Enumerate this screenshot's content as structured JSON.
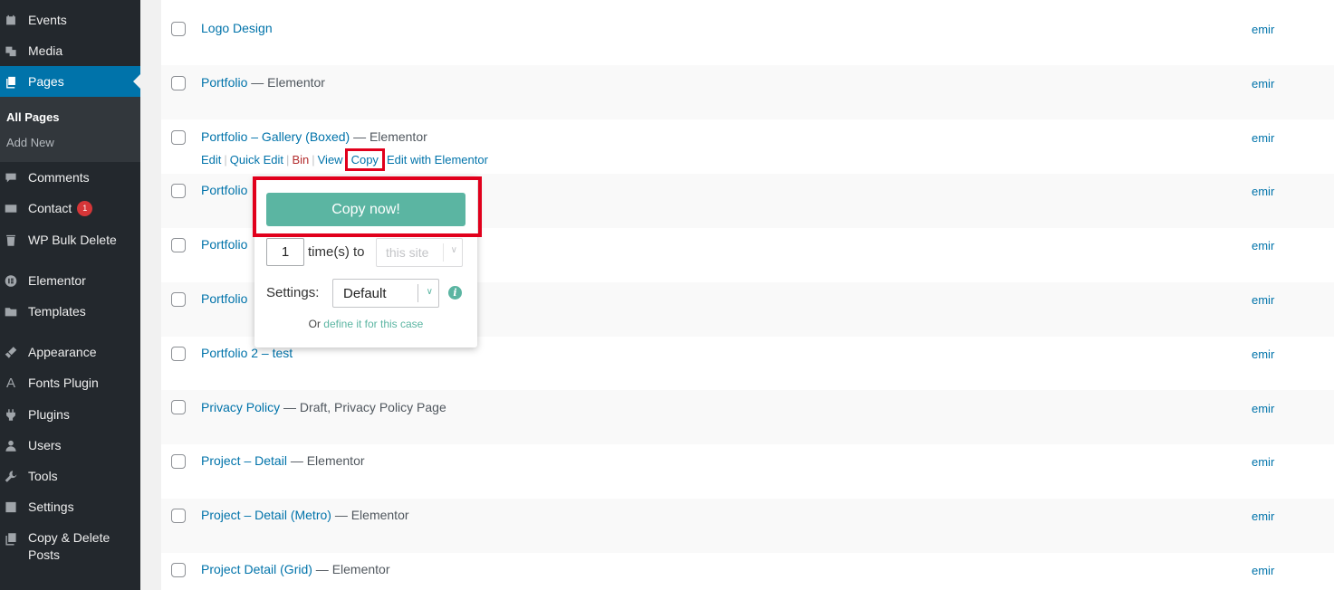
{
  "sidebar": {
    "items": [
      {
        "label": "Events",
        "icon": "calendar-icon"
      },
      {
        "label": "Media",
        "icon": "media-icon"
      },
      {
        "label": "Pages",
        "icon": "pages-icon"
      },
      {
        "label": "Comments",
        "icon": "comments-icon"
      },
      {
        "label": "Contact",
        "icon": "mail-icon",
        "badge": "1"
      },
      {
        "label": "WP Bulk Delete",
        "icon": "trash-icon"
      },
      {
        "label": "Elementor",
        "icon": "elementor-icon"
      },
      {
        "label": "Templates",
        "icon": "folder-icon"
      },
      {
        "label": "Appearance",
        "icon": "brush-icon"
      },
      {
        "label": "Fonts Plugin",
        "icon": "font-icon"
      },
      {
        "label": "Plugins",
        "icon": "plugin-icon"
      },
      {
        "label": "Users",
        "icon": "user-icon"
      },
      {
        "label": "Tools",
        "icon": "wrench-icon"
      },
      {
        "label": "Settings",
        "icon": "settings-icon"
      },
      {
        "label_line1": "Copy & Delete",
        "label_line2": "Posts",
        "icon": "copy-delete-icon"
      }
    ],
    "submenu": {
      "all_pages": "All Pages",
      "add_new": "Add New"
    }
  },
  "pages": [
    {
      "title": "Logo Design",
      "state": "",
      "author": "emir"
    },
    {
      "title": "Portfolio",
      "state": " — Elementor",
      "author": "emir"
    },
    {
      "title": "Portfolio – Gallery (Boxed)",
      "state": " — Elementor",
      "author": "emir"
    },
    {
      "title": "Portfolio",
      "state": "",
      "author": "emir"
    },
    {
      "title": "Portfolio",
      "state": "",
      "author": "emir"
    },
    {
      "title": "Portfolio",
      "state": "",
      "author": "emir"
    },
    {
      "title": "Portfolio 2 – test",
      "state": "",
      "author": "emir"
    },
    {
      "title": "Privacy Policy",
      "state": " — Draft, Privacy Policy Page",
      "author": "emir"
    },
    {
      "title": "Project – Detail",
      "state": " — Elementor",
      "author": "emir"
    },
    {
      "title": "Project – Detail (Metro)",
      "state": " — Elementor",
      "author": "emir"
    },
    {
      "title": "Project Detail (Grid)",
      "state": " — Elementor",
      "author": "emir"
    }
  ],
  "row_actions": {
    "edit": "Edit",
    "quick_edit": "Quick Edit",
    "bin": "Bin",
    "view": "View",
    "copy": "Copy",
    "edit_elementor": "Edit with Elementor",
    "separator": "|"
  },
  "copy_popup": {
    "copy_button": "Copy now!",
    "times_value": "1",
    "times_label": "time(s) to",
    "site_placeholder": "this site",
    "settings_label": "Settings:",
    "settings_value": "Default",
    "info_glyph": "i",
    "define_prefix": "Or ",
    "define_link": "define it for this case"
  },
  "colors": {
    "sidebar_bg": "#23282d",
    "active_bg": "#0073aa",
    "link": "#0073aa",
    "accent": "#5bb5a2",
    "highlight": "#e1001c",
    "badge": "#d63638"
  }
}
